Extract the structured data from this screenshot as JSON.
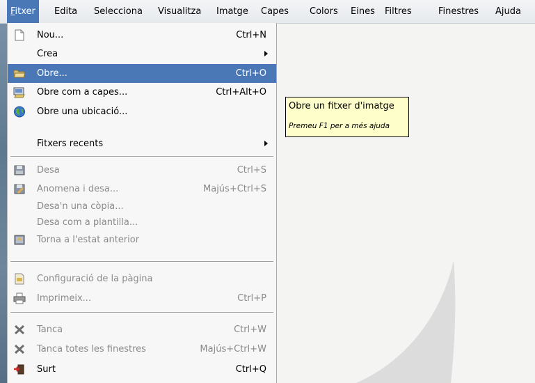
{
  "menubar": {
    "items": [
      "Fitxer",
      "Edita",
      "Selecciona",
      "Visualitza",
      "Imatge",
      "Capes",
      "Colors",
      "Eines",
      "Filtres",
      "Finestres",
      "Ajuda"
    ],
    "active": "Fitxer"
  },
  "file_menu": {
    "items": [
      {
        "label": "Nou...",
        "shortcut": "Ctrl+N",
        "icon": "new-document-icon",
        "state": "normal"
      },
      {
        "label": "Crea",
        "submenu": true,
        "state": "normal"
      },
      {
        "label": "Obre...",
        "shortcut": "Ctrl+O",
        "icon": "folder-open-icon",
        "state": "highlighted"
      },
      {
        "label": "Obre com a capes...",
        "shortcut": "Ctrl+Alt+O",
        "icon": "open-as-layers-icon",
        "state": "normal"
      },
      {
        "label": "Obre una ubicació...",
        "icon": "globe-icon",
        "state": "normal"
      },
      {
        "label": "Fitxers recents",
        "submenu": true,
        "state": "normal"
      },
      {
        "label": "Desa",
        "shortcut": "Ctrl+S",
        "icon": "save-icon",
        "state": "disabled"
      },
      {
        "label": "Anomena i desa...",
        "shortcut": "Majús+Ctrl+S",
        "icon": "save-as-icon",
        "state": "disabled"
      },
      {
        "label": "Desa'n una còpia...",
        "state": "disabled"
      },
      {
        "label": "Desa com a plantilla...",
        "state": "disabled"
      },
      {
        "label": "Torna a l'estat anterior",
        "icon": "revert-icon",
        "state": "disabled"
      },
      {
        "label": "Configuració de la pàgina",
        "icon": "page-setup-icon",
        "state": "disabled"
      },
      {
        "label": "Imprimeix...",
        "shortcut": "Ctrl+P",
        "icon": "print-icon",
        "state": "disabled"
      },
      {
        "label": "Tanca",
        "shortcut": "Ctrl+W",
        "icon": "close-icon",
        "state": "disabled"
      },
      {
        "label": "Tanca totes les finestres",
        "shortcut": "Majús+Ctrl+W",
        "icon": "close-all-icon",
        "state": "disabled"
      },
      {
        "label": "Surt",
        "shortcut": "Ctrl+Q",
        "icon": "quit-icon",
        "state": "normal"
      }
    ]
  },
  "tooltip": {
    "title": "Obre un fitxer d'imatge",
    "hint": "Premeu F1 per a més ajuda"
  },
  "colors": {
    "highlight": "#4a78b7",
    "tooltip_bg": "#fefecb",
    "disabled_text": "#8a8a8a"
  }
}
